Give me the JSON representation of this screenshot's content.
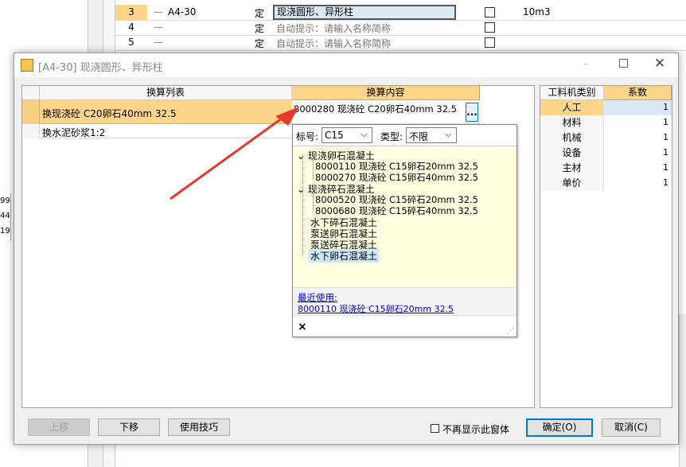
{
  "background": {
    "rows": [
      {
        "num": "3",
        "code": "A4-30",
        "type": "定",
        "name": "现浇圆形、异形柱",
        "unit": "10m3"
      },
      {
        "num": "4",
        "code": "",
        "type": "定",
        "name": "自动提示：请输入名称简称",
        "unit": ""
      },
      {
        "num": "5",
        "code": "",
        "type": "定",
        "name": "自动提示：请输入名称简称",
        "unit": ""
      }
    ],
    "left_values": [
      "99",
      "44",
      "19"
    ]
  },
  "dialog": {
    "title": "[A4-30] 现浇圆形、异形柱",
    "list_header": "换算列表",
    "list_items": [
      "换现浇砼 C20卵石40mm 32.5",
      "换水泥砂浆1:2"
    ],
    "content_header": "换算内容",
    "content_value": "8000280  现浇砼 C20卵石40mm 32.5",
    "ellipsis": "...",
    "popup": {
      "grade_label": "标号:",
      "grade_value": "C15",
      "type_label": "类型:",
      "type_value": "不限",
      "groups": [
        {
          "label": "现浇卵石混凝土",
          "children": [
            "8000110  现浇砼 C15卵石20mm 32.5",
            "8000270  现浇砼 C15卵石40mm 32.5"
          ]
        },
        {
          "label": "现浇碎石混凝土",
          "children": [
            "8000520  现浇砼 C15碎石20mm 32.5",
            "8000680  现浇砼 C15碎石40mm 32.5"
          ]
        }
      ],
      "leaf_groups": [
        "水下碎石混凝土",
        "泵送卵石混凝土",
        "泵送碎石混凝土",
        "水下卵石混凝土"
      ],
      "recent_label": "最近使用:",
      "recent_item": "8000110  现浇砼 C15卵石20mm 32.5",
      "close": "×"
    },
    "coef_headers": [
      "工料机类别",
      "系数"
    ],
    "coef_rows": [
      {
        "name": "人工",
        "value": "1"
      },
      {
        "name": "材料",
        "value": "1"
      },
      {
        "name": "机械",
        "value": "1"
      },
      {
        "name": "设备",
        "value": "1"
      },
      {
        "name": "主材",
        "value": "1"
      },
      {
        "name": "单价",
        "value": "1"
      }
    ],
    "buttons": {
      "up": "上移",
      "down": "下移",
      "tips": "使用技巧",
      "no_show": "不再显示此窗体",
      "ok": "确定(O)",
      "cancel": "取消(C)"
    }
  },
  "colors": {
    "header_orange": "#fdd68c",
    "arrow": "#e8392e",
    "popup_bg": "#ffffe1",
    "selected_row": "#fdd68c"
  }
}
